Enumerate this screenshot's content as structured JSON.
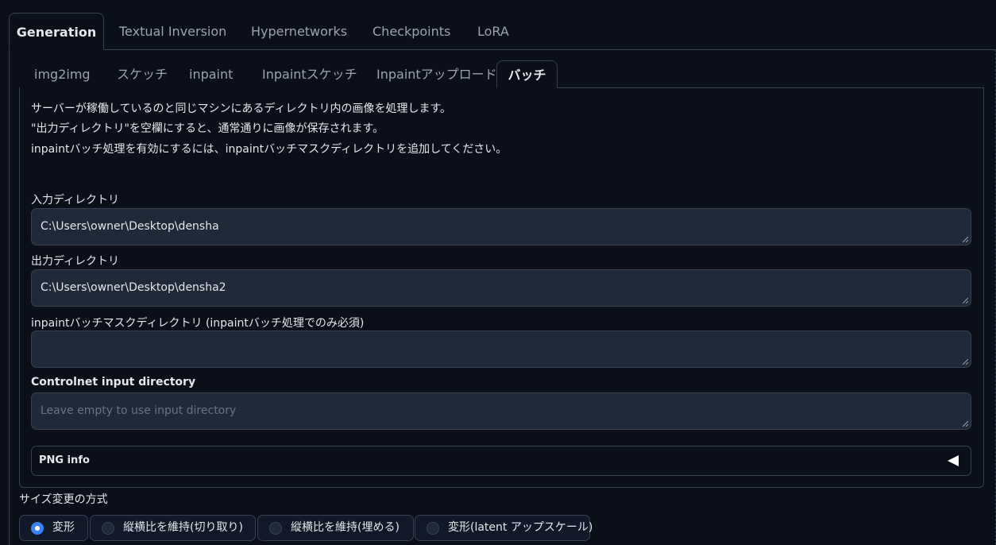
{
  "top_tabs": [
    "Generation",
    "Textual Inversion",
    "Hypernetworks",
    "Checkpoints",
    "LoRA"
  ],
  "sub_tabs": [
    "img2img",
    "スケッチ",
    "inpaint",
    "Inpaintスケッチ",
    "Inpaintアップロード",
    "バッチ"
  ],
  "active_sub_tab": "バッチ",
  "description": [
    "サーバーが稼働しているのと同じマシンにあるディレクトリ内の画像を処理します。",
    "\"出力ディレクトリ\"を空欄にすると、通常通りに画像が保存されます。",
    "inpaintバッチ処理を有効にするには、inpaintバッチマスクディレクトリを追加してください。"
  ],
  "fields": {
    "input_dir": {
      "label": "入力ディレクトリ",
      "value": "C:\\Users\\owner\\Desktop\\densha"
    },
    "output_dir": {
      "label": "出力ディレクトリ",
      "value": "C:\\Users\\owner\\Desktop\\densha2"
    },
    "mask_dir": {
      "label": "inpaintバッチマスクディレクトリ (inpaintバッチ処理でのみ必須)",
      "value": ""
    },
    "controlnet_dir": {
      "label": "Controlnet input directory",
      "value": "",
      "placeholder": "Leave empty to use input directory"
    }
  },
  "png_info": {
    "label": "PNG info"
  },
  "resize": {
    "title": "サイズ変更の方式",
    "options": [
      "変形",
      "縦横比を維持(切り取り)",
      "縦横比を維持(埋める)",
      "変形(latent アップスケール)"
    ],
    "selected": "変形"
  },
  "colors": {
    "background": "#0b0f19",
    "field": "#1f2937",
    "border": "#374151",
    "accent": "#3b82f6"
  }
}
